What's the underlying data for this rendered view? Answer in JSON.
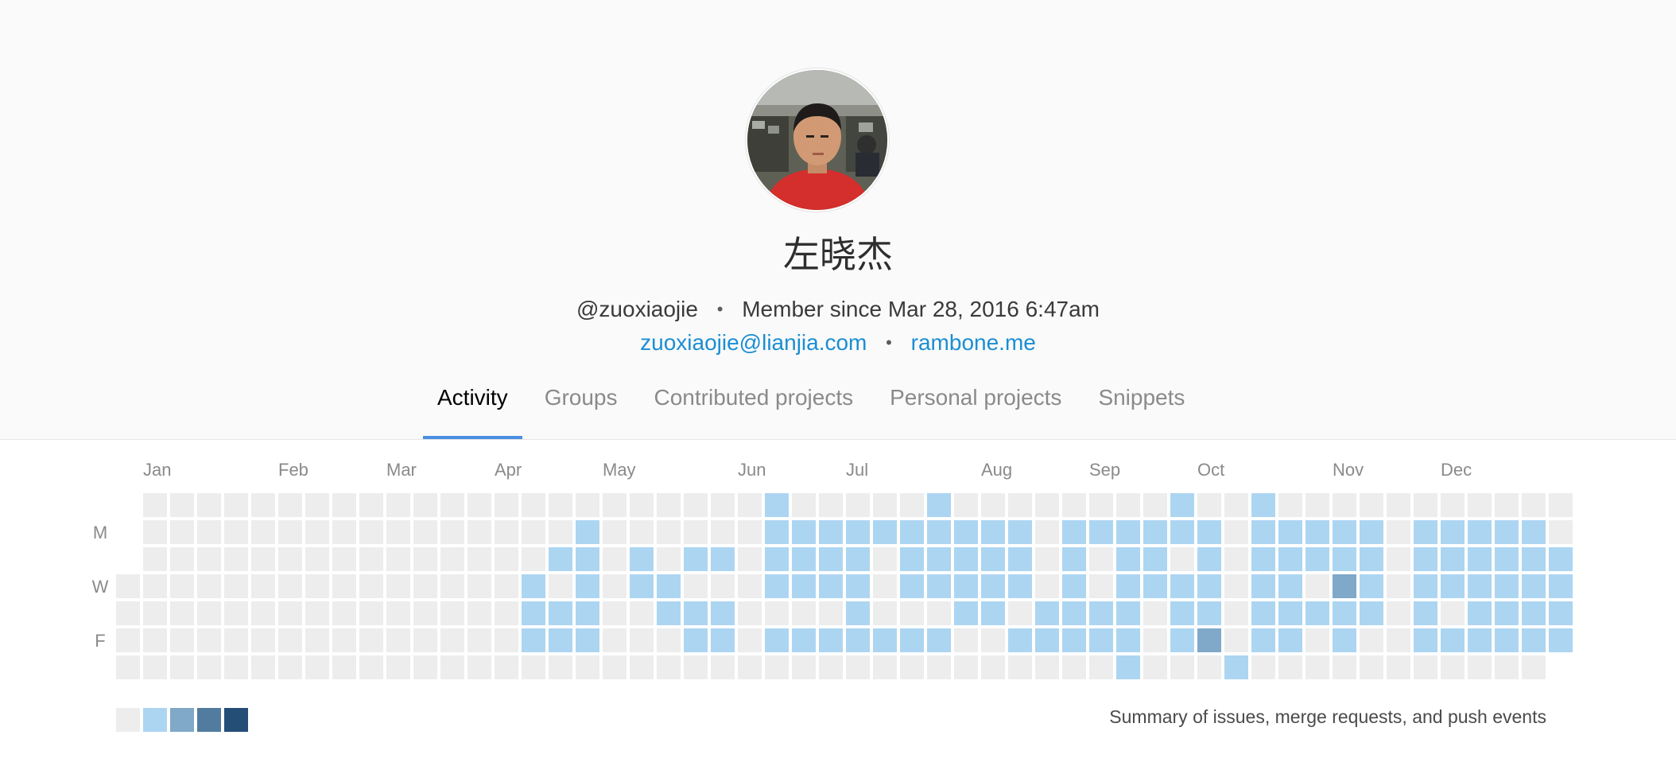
{
  "profile": {
    "name": "左晓杰",
    "username": "@zuoxiaojie",
    "member_since": "Member since Mar 28, 2016 6:47am",
    "email": "zuoxiaojie@lianjia.com",
    "website": "rambone.me",
    "separator": "•"
  },
  "tabs": [
    {
      "label": "Activity",
      "active": true
    },
    {
      "label": "Groups",
      "active": false
    },
    {
      "label": "Contributed projects",
      "active": false
    },
    {
      "label": "Personal projects",
      "active": false
    },
    {
      "label": "Snippets",
      "active": false
    }
  ],
  "calendar": {
    "months": [
      {
        "label": "Jan",
        "week": 1
      },
      {
        "label": "Feb",
        "week": 6
      },
      {
        "label": "Mar",
        "week": 10
      },
      {
        "label": "Apr",
        "week": 14
      },
      {
        "label": "May",
        "week": 18
      },
      {
        "label": "Jun",
        "week": 23
      },
      {
        "label": "Jul",
        "week": 27
      },
      {
        "label": "Aug",
        "week": 32
      },
      {
        "label": "Sep",
        "week": 36
      },
      {
        "label": "Oct",
        "week": 40
      },
      {
        "label": "Nov",
        "week": 45
      },
      {
        "label": "Dec",
        "week": 49
      }
    ],
    "day_labels": [
      {
        "label": "M",
        "row": 1
      },
      {
        "label": "W",
        "row": 3
      },
      {
        "label": "F",
        "row": 5
      }
    ],
    "colors": [
      "#ededed",
      "#acd5f2",
      "#7fa8c9",
      "#527ba0",
      "#254e77"
    ],
    "weeks": 53,
    "first_week_start_row": 3,
    "last_week_end_row": 5,
    "active_cells": [
      [
        15,
        3
      ],
      [
        15,
        4
      ],
      [
        15,
        5
      ],
      [
        16,
        2
      ],
      [
        16,
        4
      ],
      [
        16,
        5
      ],
      [
        17,
        1
      ],
      [
        17,
        2
      ],
      [
        17,
        3
      ],
      [
        17,
        4
      ],
      [
        17,
        5
      ],
      [
        19,
        2
      ],
      [
        19,
        3
      ],
      [
        20,
        3
      ],
      [
        20,
        4
      ],
      [
        21,
        2
      ],
      [
        21,
        4
      ],
      [
        21,
        5
      ],
      [
        22,
        2
      ],
      [
        22,
        4
      ],
      [
        22,
        5
      ],
      [
        24,
        0
      ],
      [
        24,
        1
      ],
      [
        24,
        2
      ],
      [
        24,
        3
      ],
      [
        24,
        5
      ],
      [
        25,
        1
      ],
      [
        25,
        2
      ],
      [
        25,
        3
      ],
      [
        25,
        5
      ],
      [
        26,
        1
      ],
      [
        26,
        2
      ],
      [
        26,
        3
      ],
      [
        26,
        5
      ],
      [
        27,
        1
      ],
      [
        27,
        2
      ],
      [
        27,
        3
      ],
      [
        27,
        4
      ],
      [
        27,
        5
      ],
      [
        28,
        1
      ],
      [
        28,
        5
      ],
      [
        29,
        1
      ],
      [
        29,
        2
      ],
      [
        29,
        3
      ],
      [
        29,
        5
      ],
      [
        30,
        0
      ],
      [
        30,
        1
      ],
      [
        30,
        2
      ],
      [
        30,
        3
      ],
      [
        30,
        5
      ],
      [
        31,
        1
      ],
      [
        31,
        2
      ],
      [
        31,
        3
      ],
      [
        31,
        4
      ],
      [
        32,
        1
      ],
      [
        32,
        2
      ],
      [
        32,
        3
      ],
      [
        32,
        4
      ],
      [
        33,
        1
      ],
      [
        33,
        2
      ],
      [
        33,
        3
      ],
      [
        33,
        5
      ],
      [
        34,
        4
      ],
      [
        34,
        5
      ],
      [
        35,
        1
      ],
      [
        35,
        2
      ],
      [
        35,
        3
      ],
      [
        35,
        4
      ],
      [
        35,
        5
      ],
      [
        36,
        1
      ],
      [
        36,
        4
      ],
      [
        36,
        5
      ],
      [
        37,
        1
      ],
      [
        37,
        2
      ],
      [
        37,
        3
      ],
      [
        37,
        4
      ],
      [
        37,
        5
      ],
      [
        37,
        6
      ],
      [
        38,
        1
      ],
      [
        38,
        2
      ],
      [
        38,
        3
      ],
      [
        39,
        0
      ],
      [
        39,
        1
      ],
      [
        39,
        3
      ],
      [
        39,
        4
      ],
      [
        39,
        5
      ],
      [
        40,
        1
      ],
      [
        40,
        2
      ],
      [
        40,
        3
      ],
      [
        40,
        4
      ],
      [
        41,
        6
      ],
      [
        42,
        0
      ],
      [
        42,
        1
      ],
      [
        42,
        2
      ],
      [
        42,
        3
      ],
      [
        42,
        4
      ],
      [
        42,
        5
      ],
      [
        43,
        1
      ],
      [
        43,
        2
      ],
      [
        43,
        3
      ],
      [
        43,
        4
      ],
      [
        43,
        5
      ],
      [
        44,
        1
      ],
      [
        44,
        2
      ],
      [
        44,
        4
      ],
      [
        45,
        1
      ],
      [
        45,
        2
      ],
      [
        45,
        4
      ],
      [
        45,
        5
      ],
      [
        46,
        1
      ],
      [
        46,
        2
      ],
      [
        46,
        3
      ],
      [
        46,
        4
      ],
      [
        48,
        1
      ],
      [
        48,
        2
      ],
      [
        48,
        3
      ],
      [
        48,
        4
      ],
      [
        48,
        5
      ],
      [
        49,
        1
      ],
      [
        49,
        2
      ],
      [
        49,
        3
      ],
      [
        49,
        5
      ],
      [
        50,
        1
      ],
      [
        50,
        2
      ],
      [
        50,
        3
      ],
      [
        50,
        4
      ],
      [
        50,
        5
      ],
      [
        51,
        1
      ],
      [
        51,
        2
      ],
      [
        51,
        3
      ],
      [
        51,
        4
      ],
      [
        51,
        5
      ],
      [
        52,
        1
      ],
      [
        52,
        2
      ],
      [
        52,
        3
      ],
      [
        52,
        4
      ],
      [
        52,
        5
      ],
      [
        53,
        2
      ],
      [
        53,
        3
      ],
      [
        53,
        4
      ],
      [
        53,
        5
      ]
    ],
    "level2_cells": [
      [
        45,
        3
      ],
      [
        40,
        5
      ]
    ],
    "summary": "Summary of issues, merge requests, and push events"
  }
}
